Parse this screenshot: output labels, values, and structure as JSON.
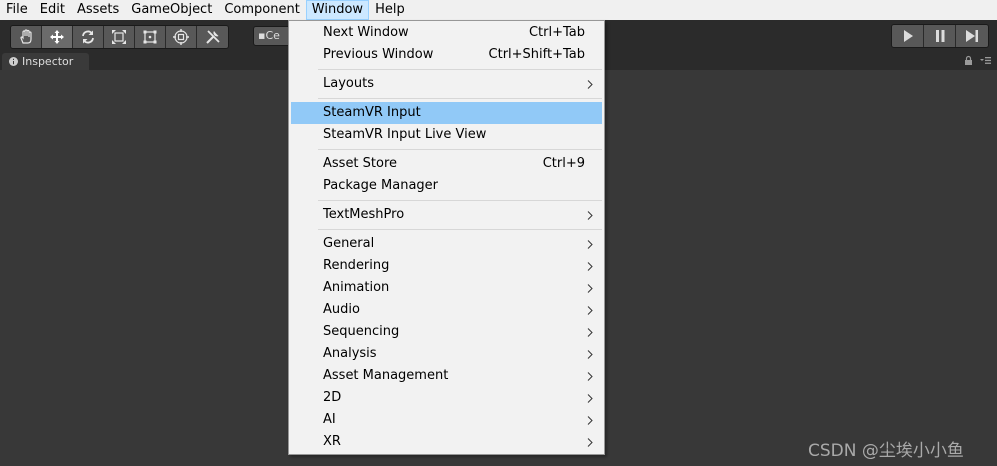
{
  "menubar": {
    "items": [
      "File",
      "Edit",
      "Assets",
      "GameObject",
      "Component",
      "Window",
      "Help"
    ],
    "active": "Window"
  },
  "toolbar": {
    "tools": [
      "hand-tool-icon",
      "move-tool-icon",
      "rotate-tool-icon",
      "scale-tool-icon",
      "rect-tool-icon",
      "transform-tool-icon",
      "custom-tool-icon"
    ],
    "pivot_label": "Ce",
    "playback": [
      "play-icon",
      "pause-icon",
      "step-icon"
    ]
  },
  "inspector": {
    "tab_label": "Inspector"
  },
  "window_menu": {
    "highlighted": "SteamVR Input",
    "items": [
      {
        "label": "Next Window",
        "shortcut": "Ctrl+Tab"
      },
      {
        "label": "Previous Window",
        "shortcut": "Ctrl+Shift+Tab"
      },
      {
        "label": "Layouts",
        "submenu": true
      },
      {
        "label": "SteamVR Input"
      },
      {
        "label": "SteamVR Input Live View"
      },
      {
        "label": "Asset Store",
        "shortcut": "Ctrl+9"
      },
      {
        "label": "Package Manager"
      },
      {
        "label": "TextMeshPro",
        "submenu": true
      },
      {
        "label": "General",
        "submenu": true
      },
      {
        "label": "Rendering",
        "submenu": true
      },
      {
        "label": "Animation",
        "submenu": true
      },
      {
        "label": "Audio",
        "submenu": true
      },
      {
        "label": "Sequencing",
        "submenu": true
      },
      {
        "label": "Analysis",
        "submenu": true
      },
      {
        "label": "Asset Management",
        "submenu": true
      },
      {
        "label": "2D",
        "submenu": true
      },
      {
        "label": "AI",
        "submenu": true
      },
      {
        "label": "XR",
        "submenu": true
      }
    ]
  },
  "watermark": "CSDN @尘埃小小鱼",
  "colors": {
    "menubar_bg": "#f0f0f0",
    "menu_highlight": "#91c9f7",
    "active_menu_bg": "#cce8ff",
    "editor_bg": "#383838"
  }
}
